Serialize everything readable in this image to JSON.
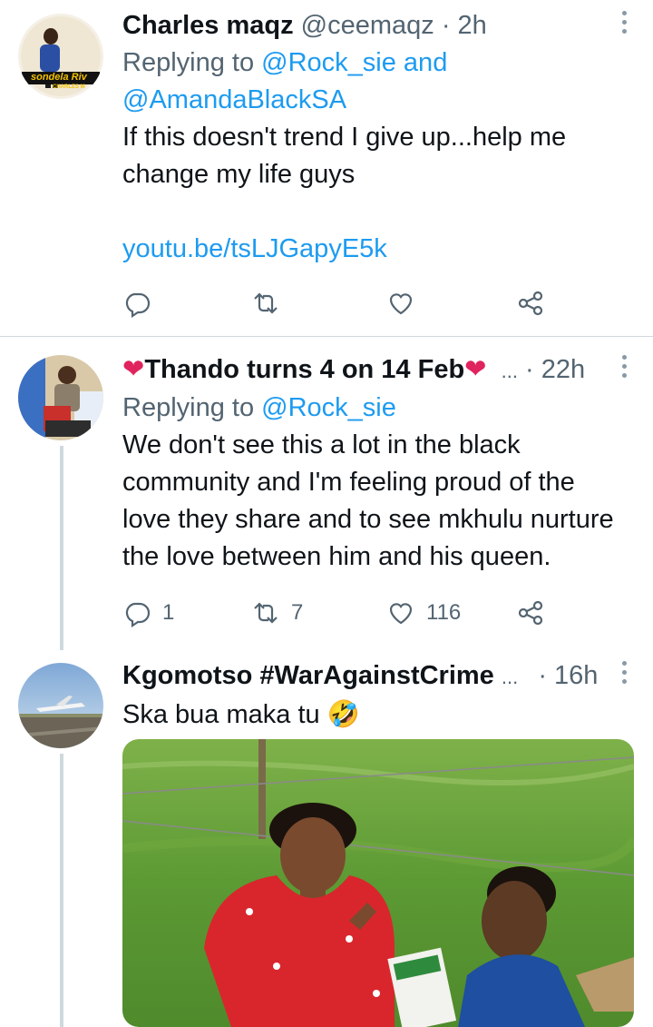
{
  "tweets": [
    {
      "name": "Charles maqz",
      "handle": "@ceemaqz",
      "sep": " · ",
      "time": "2h",
      "replying_prefix": "Replying to ",
      "mentions_line1": "@Rock_sie",
      "and_word": " and",
      "mentions_line2": "@AmandaBlackSA",
      "text_line1": "If this doesn't trend I give up...help me",
      "text_line2": "change my life guys",
      "link": "youtu.be/tsLJGapyE5k",
      "avatar_logo_text": "sondela Riv",
      "avatar_logo_subtext": "CHARLES M"
    },
    {
      "name_prefix": "❤",
      "name": "Thando turns 4 on 14 Feb",
      "name_suffix": "❤",
      "ellipsis": " ...",
      "sep": " · ",
      "time": "22h",
      "replying_prefix": "Replying to ",
      "mention": "@Rock_sie",
      "text_lines": [
        "We don't see this a lot in the black",
        "community and I'm feeling proud of the",
        "love they share and to see mkhulu nurture",
        "the love between him and his queen."
      ],
      "reply_count": "1",
      "retweet_count": "7",
      "like_count": "116"
    },
    {
      "name": "Kgomotso #WarAgainstCrime",
      "ellipsis": " ...",
      "sep": " · ",
      "time": "16h",
      "text": "Ska bua maka tu",
      "emoji": "🤣"
    }
  ],
  "colors": {
    "accent": "#1d9bf0",
    "secondary_text": "#536471",
    "divider": "#cfd9de",
    "heart": "#e0245e"
  },
  "icons": [
    "reply-icon",
    "retweet-icon",
    "like-icon",
    "share-icon",
    "more-icon"
  ]
}
